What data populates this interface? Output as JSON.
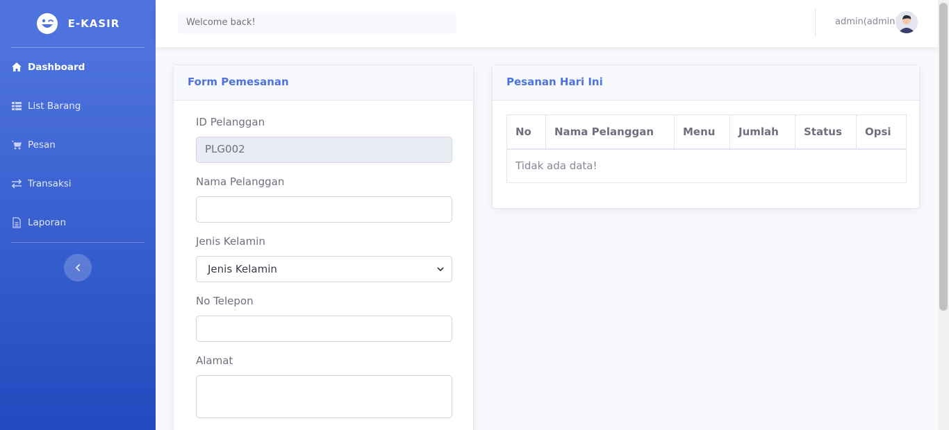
{
  "sidebar": {
    "brand": "E-KASIR",
    "items": [
      {
        "label": "Dashboard",
        "icon": "home-icon"
      },
      {
        "label": "List Barang",
        "icon": "table-icon"
      },
      {
        "label": "Pesan",
        "icon": "cart-icon"
      },
      {
        "label": "Transaksi",
        "icon": "exchange-icon"
      },
      {
        "label": "Laporan",
        "icon": "file-icon"
      }
    ],
    "toggle_icon": "chevron-left-icon"
  },
  "topbar": {
    "welcome": "Welcome back!",
    "user": "admin(admin)"
  },
  "form": {
    "title": "Form Pemesanan",
    "id_label": "ID Pelanggan",
    "id_value": "PLG002",
    "name_label": "Nama Pelanggan",
    "name_value": "",
    "gender_label": "Jenis Kelamin",
    "gender_selected": "Jenis Kelamin",
    "phone_label": "No Telepon",
    "phone_value": "",
    "address_label": "Alamat",
    "address_value": ""
  },
  "orders": {
    "title": "Pesanan Hari Ini",
    "columns": [
      "No",
      "Nama Pelanggan",
      "Menu",
      "Jumlah",
      "Status",
      "Opsi"
    ],
    "empty_text": "Tidak ada data!"
  },
  "colors": {
    "primary": "#4e73df",
    "sidebar_dark": "#224abe"
  }
}
